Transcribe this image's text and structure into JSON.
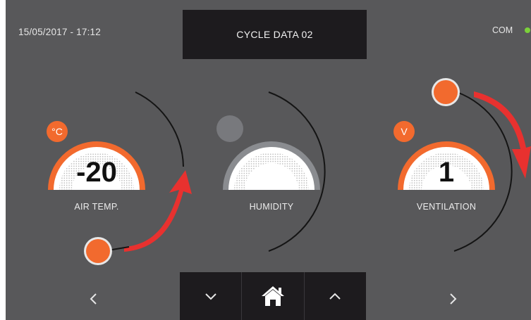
{
  "header": {
    "datetime": "15/05/2017 - 17:12",
    "title": "CYCLE DATA 02",
    "status_label": "COM",
    "status_color": "#7bd13a"
  },
  "gauges": [
    {
      "label": "AIR TEMP.",
      "value": "-20",
      "unit": "°C",
      "accent": "#f26a2e",
      "active": true
    },
    {
      "label": "HUMIDITY",
      "value": "",
      "unit": "",
      "accent": "#8a8c90",
      "active": false
    },
    {
      "label": "VENTILATION",
      "value": "1",
      "unit": "V",
      "accent": "#f26a2e",
      "active": true
    }
  ],
  "nav": {
    "prev_icon": "chevron-left-icon",
    "next_icon": "chevron-right-icon",
    "down_icon": "chevron-down-icon",
    "home_icon": "home-icon",
    "up_icon": "chevron-up-icon"
  },
  "colors": {
    "background": "#58585a",
    "panel": "#1d1b1e",
    "accent": "#f26a2e",
    "arrow": "#e8312f"
  }
}
